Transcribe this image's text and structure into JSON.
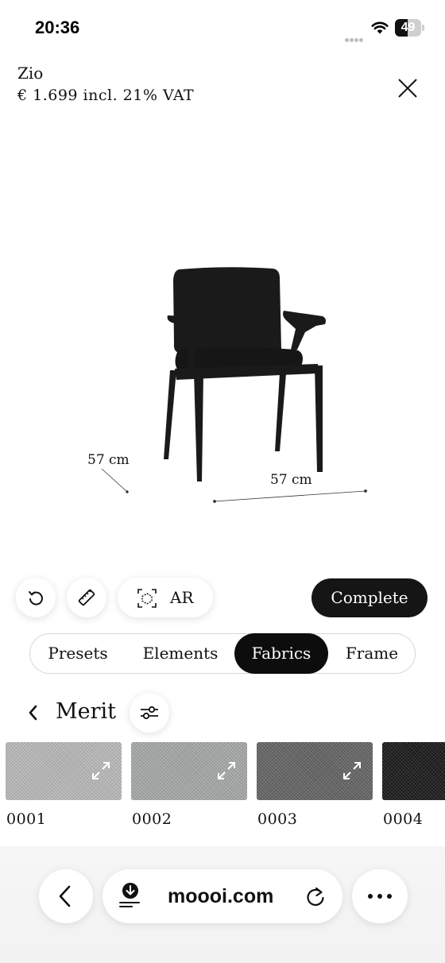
{
  "status_bar": {
    "time": "20:36",
    "battery_level": "49"
  },
  "product": {
    "name": "Zio",
    "price": "€  1.699 incl. 21% VAT"
  },
  "dimensions": {
    "depth": "57 cm",
    "width": "57 cm"
  },
  "toolbar": {
    "ar_label": "AR",
    "complete_label": "Complete"
  },
  "tabs": [
    {
      "label": "Presets",
      "active": false
    },
    {
      "label": "Elements",
      "active": false
    },
    {
      "label": "Fabrics",
      "active": true
    },
    {
      "label": "Frame",
      "active": false
    }
  ],
  "collection": {
    "title": "Merit"
  },
  "swatches": [
    {
      "code": "0001",
      "color": "#bdbdbd"
    },
    {
      "code": "0002",
      "color": "#a9acac"
    },
    {
      "code": "0003",
      "color": "#676767"
    },
    {
      "code": "0004",
      "color": "#1c1c1c"
    }
  ],
  "browser": {
    "url": "moooi.com"
  },
  "colors": {
    "accent": "#151515",
    "chair": "#1a1a1a"
  }
}
